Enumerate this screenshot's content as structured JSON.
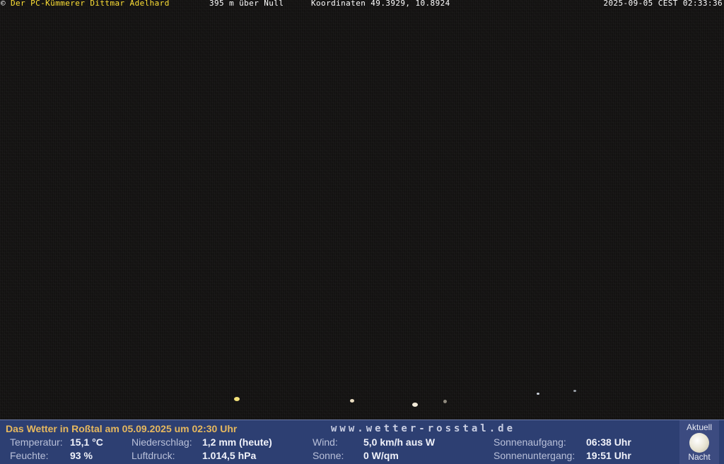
{
  "header": {
    "copyright_symbol": "©",
    "owner": "Der PC-Kümmerer Dittmar Adelhard",
    "altitude": "395 m über Null",
    "coordinates": "Koordinaten 49.3929, 10.8924",
    "timestamp": "2025-09-05 CEST 02:33:36"
  },
  "weather": {
    "heading": "Das Wetter in Roßtal am 05.09.2025 um 02:30 Uhr",
    "website": "www.wetter-rosstal.de",
    "temperatur_label": "Temperatur:",
    "temperatur_value": "15,1 °C",
    "feuchte_label": "Feuchte:",
    "feuchte_value": "93 %",
    "niederschlag_label": "Niederschlag:",
    "niederschlag_value": "1,2 mm (heute)",
    "luftdruck_label": "Luftdruck:",
    "luftdruck_value": "1.014,5 hPa",
    "wind_label": "Wind:",
    "wind_value": "5,0 km/h aus W",
    "sonne_label": "Sonne:",
    "sonne_value": "0 W/qm",
    "sonnenaufgang_label": "Sonnenaufgang:",
    "sonnenaufgang_value": "06:38 Uhr",
    "sonnenuntergang_label": "Sonnenuntergang:",
    "sonnenuntergang_value": "19:51 Uhr"
  },
  "moon": {
    "top_caption": "Aktuell",
    "bottom_caption": "Nacht",
    "icon": "moon-icon"
  },
  "colors": {
    "panel_bg": "#2d3f72",
    "heading": "#e6b85e",
    "owner": "#ffe135"
  }
}
